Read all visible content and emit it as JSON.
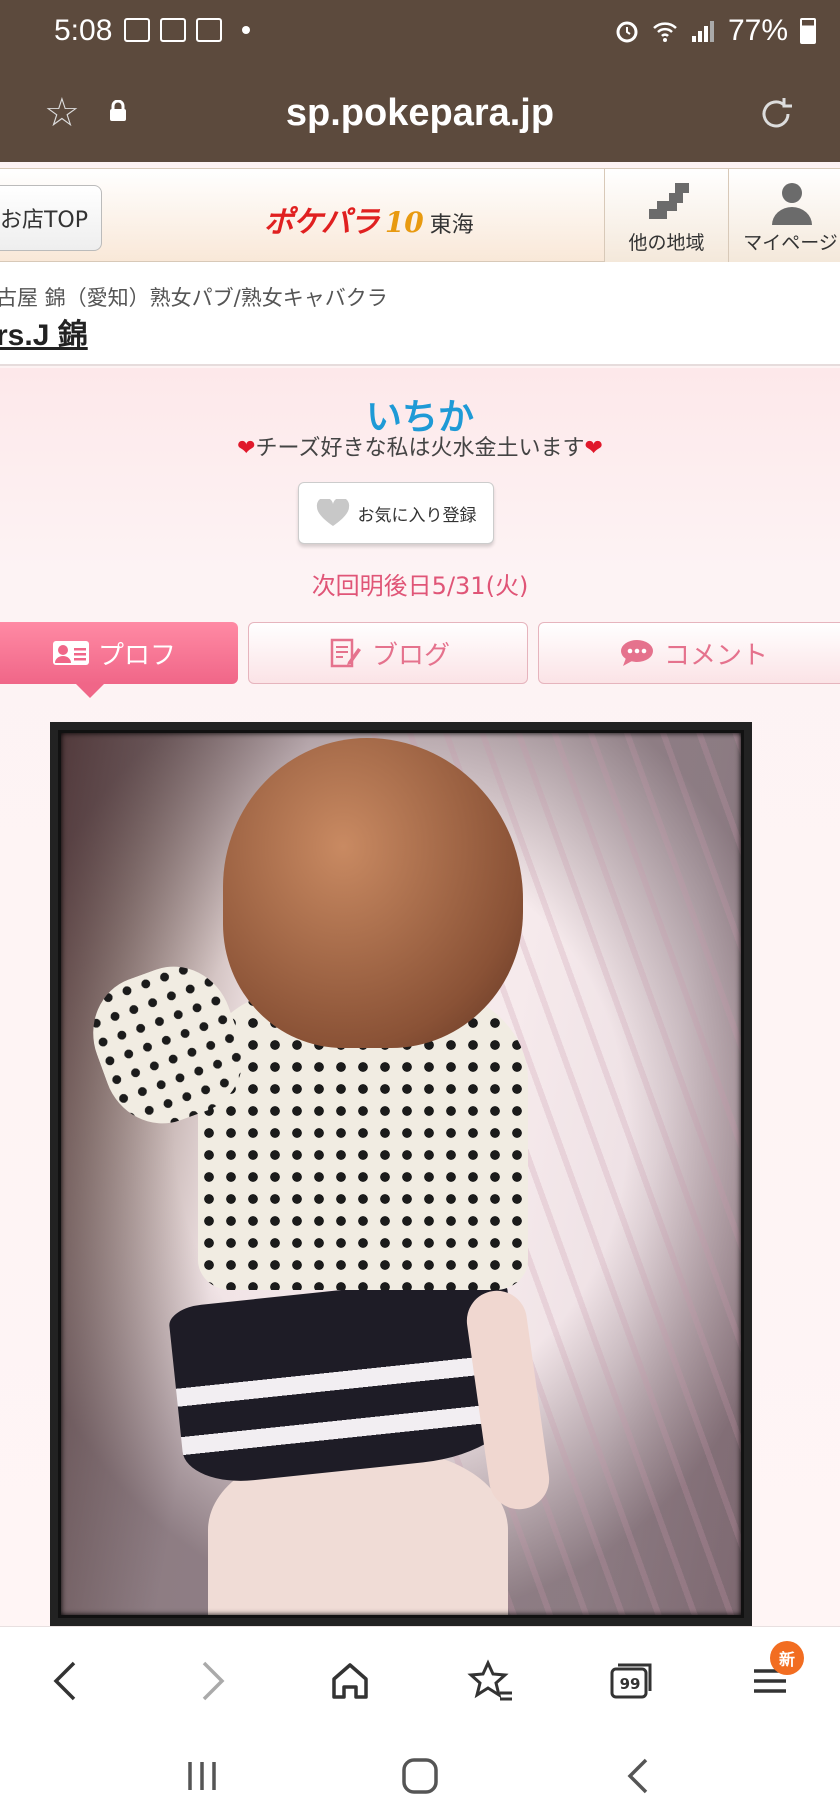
{
  "status_bar": {
    "time": "5:08",
    "battery": "77%"
  },
  "browser": {
    "url": "sp.pokepara.jp"
  },
  "site_header": {
    "shop_top_label": "お店TOP",
    "logo_main": "ポケパラ",
    "logo_10": "10",
    "logo_region": "東海",
    "nav_other_region": "他の地域",
    "nav_mypage": "マイページ"
  },
  "shop": {
    "category": "古屋 錦（愛知）熟女パブ/熟女キャバクラ",
    "name": "rs.J 錦"
  },
  "profile": {
    "name": "いちか",
    "catch_copy": "チーズ好きな私は火水金土います",
    "heart_symbol": "❤",
    "favorite_button": "お気に入り登録",
    "next_work": "次回明後日5/31(火)"
  },
  "tabs": [
    {
      "label": "プロフ",
      "active": true
    },
    {
      "label": "ブログ",
      "active": false
    },
    {
      "label": "コメント",
      "active": false
    }
  ],
  "bottom_bar": {
    "new_badge": "新",
    "tabs_count": "99"
  },
  "colors": {
    "status_bar_bg": "#5c4a3d",
    "name_color": "#1e9ad6",
    "accent_pink": "#f06688",
    "next_work_color": "#e05577",
    "new_badge_color": "#f26d21"
  }
}
